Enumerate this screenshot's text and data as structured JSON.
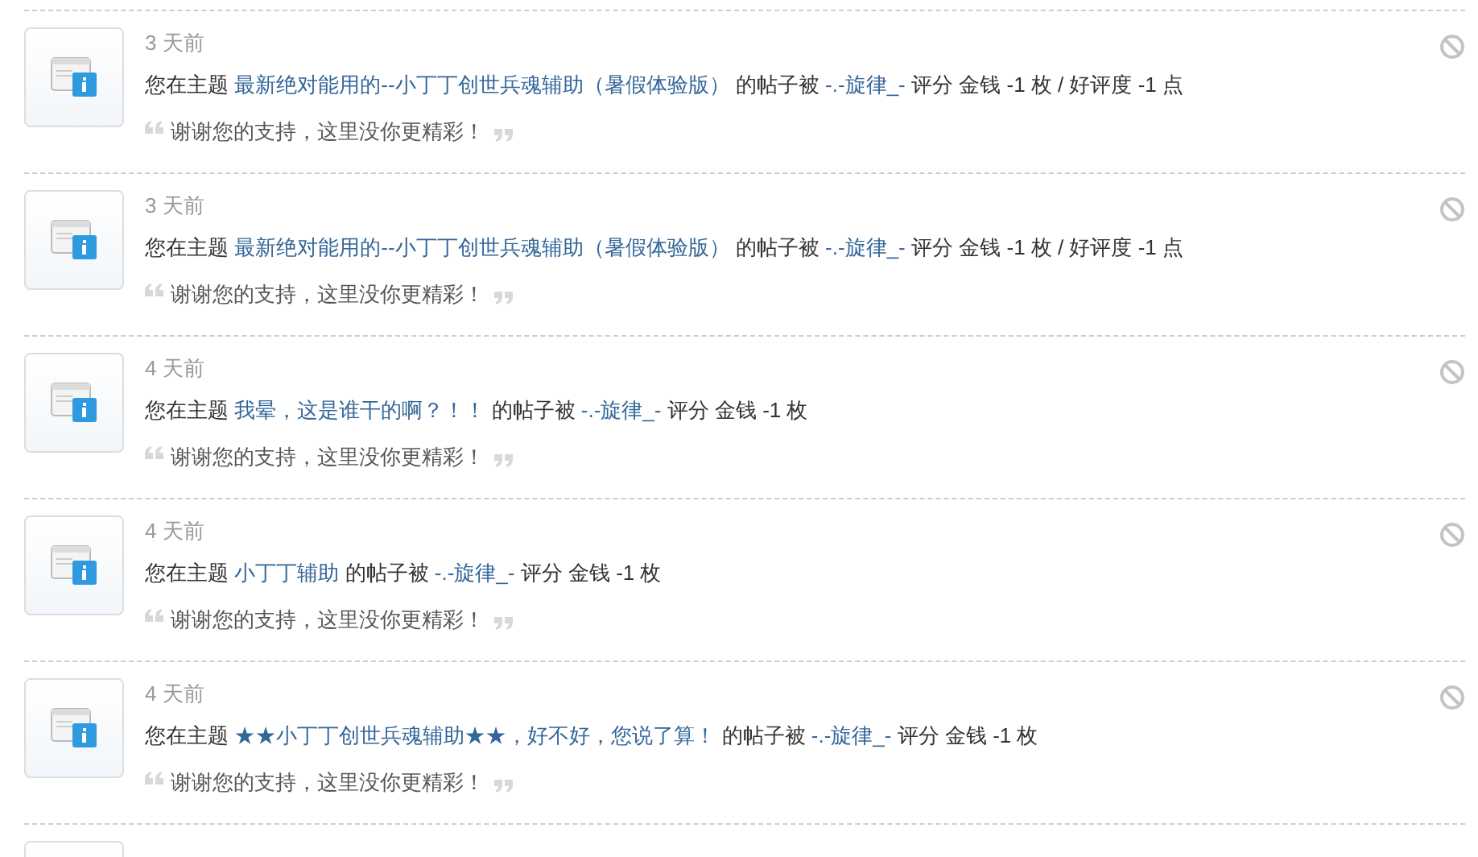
{
  "notices": [
    {
      "time": "3 天前",
      "prefix": "您在主题",
      "thread": "最新绝对能用的--小丁丁创世兵魂辅助（暑假体验版）",
      "middle": "的帖子被",
      "user": "-.-旋律_-",
      "rest": "评分 金钱 -1 枚 / 好评度 -1 点",
      "quote": "谢谢您的支持，这里没你更精彩！"
    },
    {
      "time": "3 天前",
      "prefix": "您在主题",
      "thread": "最新绝对能用的--小丁丁创世兵魂辅助（暑假体验版）",
      "middle": "的帖子被",
      "user": "-.-旋律_-",
      "rest": "评分 金钱 -1 枚 / 好评度 -1 点",
      "quote": "谢谢您的支持，这里没你更精彩！"
    },
    {
      "time": "4 天前",
      "prefix": "您在主题",
      "thread": "我晕，这是谁干的啊？！！",
      "middle": "的帖子被",
      "user": "-.-旋律_-",
      "rest": "评分 金钱 -1 枚",
      "quote": "谢谢您的支持，这里没你更精彩！"
    },
    {
      "time": "4 天前",
      "prefix": "您在主题",
      "thread": "小丁丁辅助",
      "middle": "的帖子被",
      "user": "-.-旋律_-",
      "rest": "评分 金钱 -1 枚",
      "quote": "谢谢您的支持，这里没你更精彩！"
    },
    {
      "time": "4 天前",
      "prefix": "您在主题",
      "thread": "★★小丁丁创世兵魂辅助★★，好不好，您说了算！",
      "middle": "的帖子被",
      "user": "-.-旋律_-",
      "rest": "评分 金钱 -1 枚",
      "quote": "谢谢您的支持，这里没你更精彩！"
    },
    {
      "kind": "cut"
    }
  ]
}
